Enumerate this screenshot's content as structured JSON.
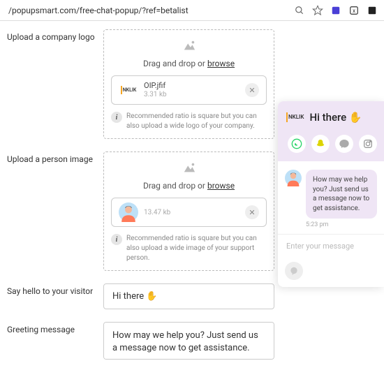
{
  "browser": {
    "url": "/popupsmart.com/free-chat-popup/?ref=betalist"
  },
  "labels": {
    "logo": "Upload a company logo",
    "person": "Upload a person image",
    "hello": "Say hello to your visitor",
    "greeting": "Greeting message"
  },
  "drop": {
    "text": "Drag and drop or ",
    "browse": "browse"
  },
  "files": {
    "logo": {
      "name": "OIP.jfif",
      "size": "3.31 kb"
    },
    "person": {
      "name": "",
      "size": "13.47 kb"
    }
  },
  "hints": {
    "logo": "Recommended ratio is square but you can also upload a wide logo of your company.",
    "person": "Recommended ratio is square but you can also upload a wide image of your support person."
  },
  "inputs": {
    "hello": "Hi there ✋",
    "greeting": "How may we help you? Just send us a message now to get assistance."
  },
  "preview": {
    "brand": "NKLIK",
    "hello": "Hi there ✋",
    "message": "How may we help you? Just send us a message now to get assistance.",
    "time": "5:23 pm",
    "placeholder": "Enter your message"
  }
}
